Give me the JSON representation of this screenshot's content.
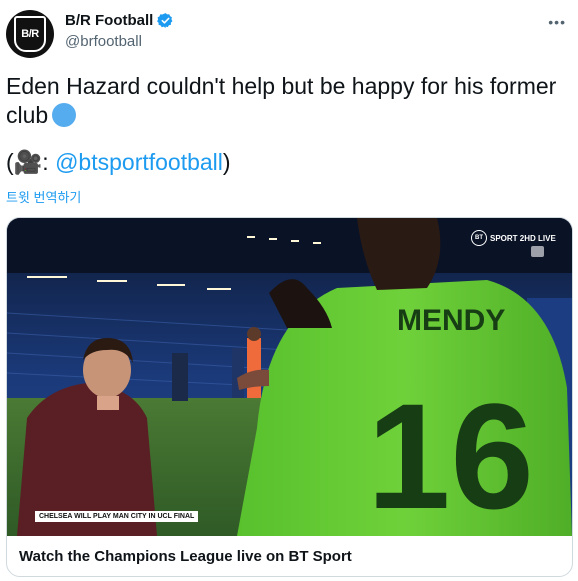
{
  "tweet": {
    "display_name": "B/R Football",
    "handle": "@brfootball",
    "more_label": "•••",
    "avatar_text": "B/R",
    "text_line1": "Eden Hazard couldn't help but be happy for his former",
    "text_line2": "club",
    "credit_prefix": "(🎥: ",
    "credit_mention": "@btsportfootball",
    "credit_suffix": ")",
    "translate_label": "트윗 번역하기"
  },
  "card": {
    "title": "Watch the Champions League live on BT Sport",
    "broadcaster": "SPORT 2HD LIVE",
    "broadcaster_mark": "BT",
    "caption": "CHELSEA WILL PLAY MAN CITY IN UCL FINAL",
    "jersey_name": "MENDY",
    "jersey_number": "16"
  },
  "colors": {
    "link": "#1d9bf0",
    "verified": "#1d9bf0",
    "jersey": "#6fd13a",
    "emoji_circle": "#55acee"
  },
  "icons": [
    "verified-badge-icon",
    "more-options-icon",
    "camera-icon"
  ]
}
